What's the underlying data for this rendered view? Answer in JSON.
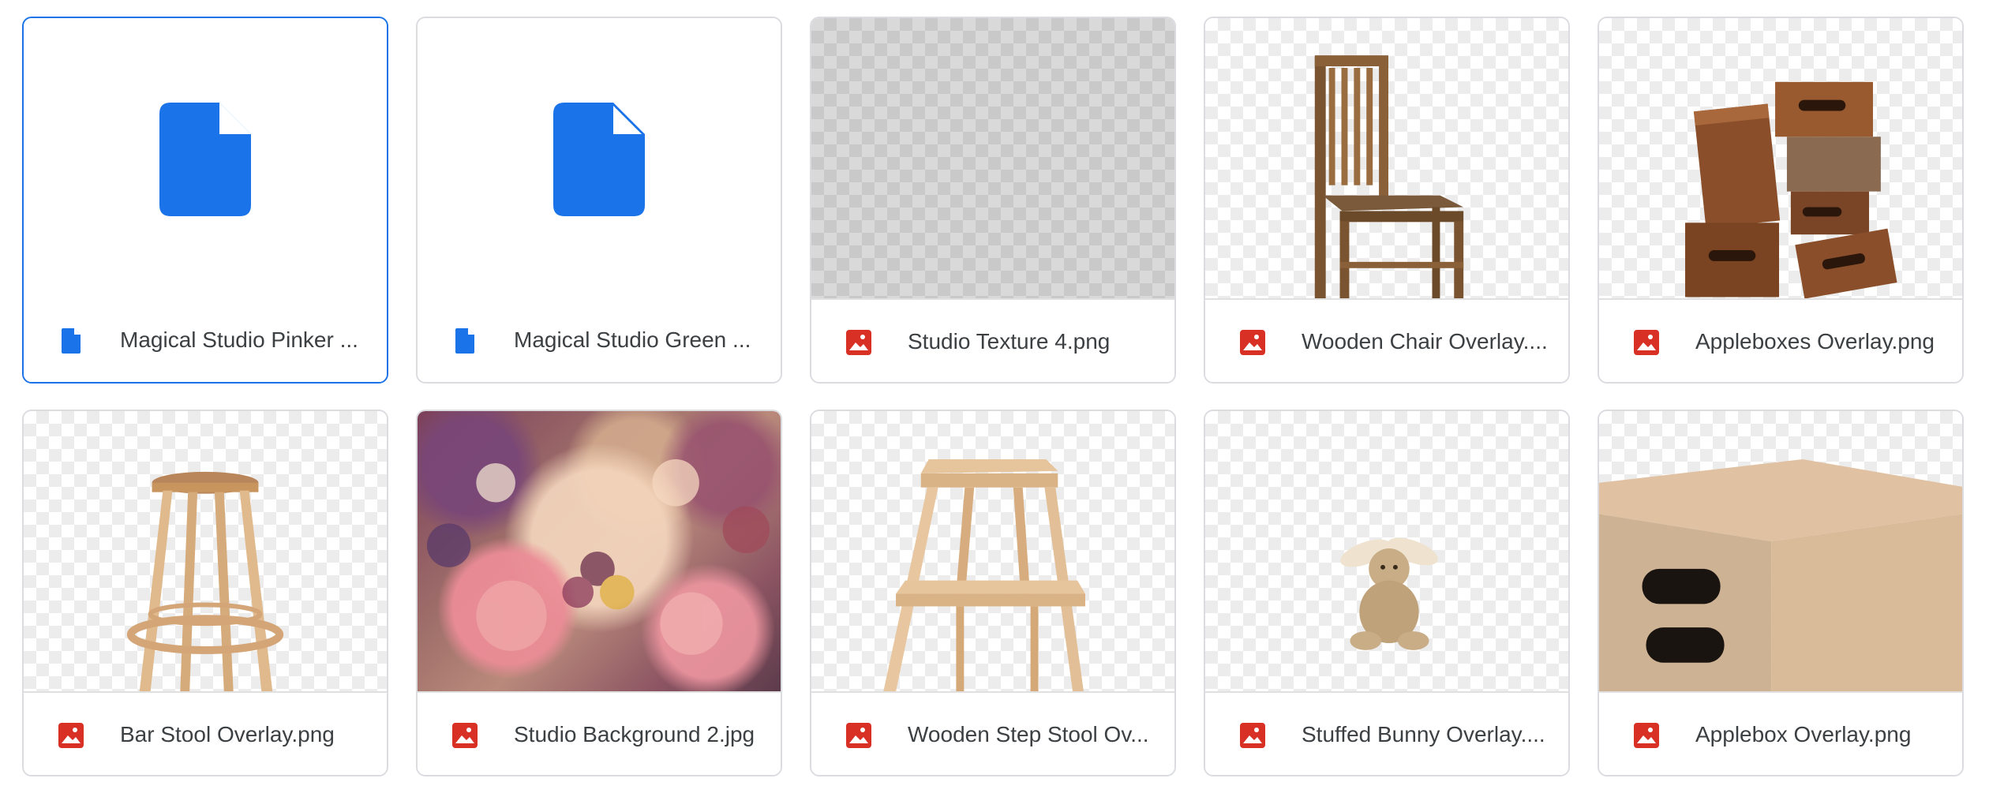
{
  "files": [
    {
      "name": "Magical Studio Pinker ...",
      "type": "doc",
      "icon": "doc-icon",
      "thumbnail": "document-icon-thumb",
      "selected": true
    },
    {
      "name": "Magical Studio Green ...",
      "type": "doc",
      "icon": "doc-icon",
      "thumbnail": "document-icon-thumb",
      "selected": false
    },
    {
      "name": "Studio Texture 4.png",
      "type": "image",
      "icon": "image-icon",
      "thumbnail": "gray-texture",
      "selected": false
    },
    {
      "name": "Wooden Chair Overlay....",
      "type": "image",
      "icon": "image-icon",
      "thumbnail": "wooden-chair",
      "selected": false
    },
    {
      "name": "Appleboxes Overlay.png",
      "type": "image",
      "icon": "image-icon",
      "thumbnail": "stacked-appleboxes",
      "selected": false
    },
    {
      "name": "Bar Stool Overlay.png",
      "type": "image",
      "icon": "image-icon",
      "thumbnail": "bar-stool",
      "selected": false
    },
    {
      "name": "Studio Background 2.jpg",
      "type": "image",
      "icon": "image-icon",
      "thumbnail": "floral-painting",
      "selected": false
    },
    {
      "name": "Wooden Step Stool Ov...",
      "type": "image",
      "icon": "image-icon",
      "thumbnail": "step-stool",
      "selected": false
    },
    {
      "name": "Stuffed Bunny Overlay....",
      "type": "image",
      "icon": "image-icon",
      "thumbnail": "stuffed-bunny",
      "selected": false
    },
    {
      "name": "Applebox Overlay.png",
      "type": "image",
      "icon": "image-icon",
      "thumbnail": "applebox",
      "selected": false
    }
  ],
  "colors": {
    "doc_blue": "#1a73e8",
    "image_red": "#d93025",
    "selected_border": "#1a73e8",
    "card_border": "#dadce0"
  }
}
